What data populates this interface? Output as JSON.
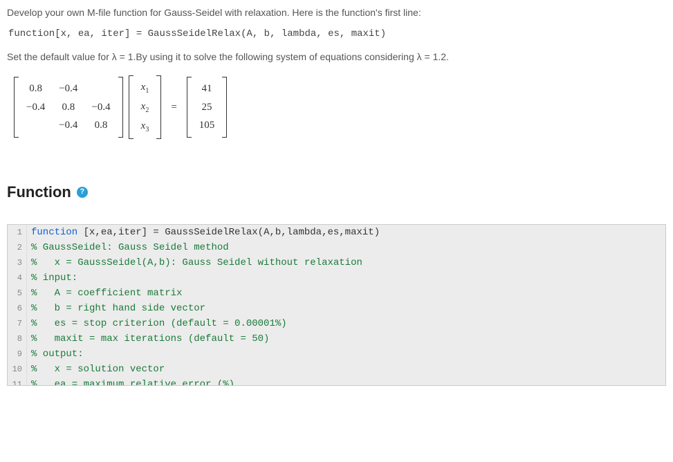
{
  "problem": {
    "intro": "Develop your own M-file function for Gauss-Seidel with relaxation. Here is the function's first line:",
    "code_signature_pre": "function",
    "code_signature_mid": "[x, ea, iter] = GaussSeidelRelax(A, b, lambda, es, maxit)",
    "text2_a": "Set the default value for λ = 1.By using it to solve the following system of equations considering λ = 1.2."
  },
  "matrixA": {
    "r1c1": "0.8",
    "r1c2": "−0.4",
    "r1c3": "",
    "r2c1": "−0.4",
    "r2c2": "0.8",
    "r2c3": "−0.4",
    "r3c1": "",
    "r3c2": "−0.4",
    "r3c3": "0.8"
  },
  "xvec": {
    "x1": "x",
    "x1s": "1",
    "x2": "x",
    "x2s": "2",
    "x3": "x",
    "x3s": "3"
  },
  "eq": "=",
  "bvec": {
    "b1": "41",
    "b2": "25",
    "b3": "105"
  },
  "section": {
    "title": "Function",
    "help": "?"
  },
  "code": {
    "lines": [
      {
        "n": "1",
        "kw": "function",
        "rest": " [x,ea,iter] = GaussSeidelRelax(A,b,lambda,es,maxit)"
      },
      {
        "n": "2",
        "rest": "% GaussSeidel: Gauss Seidel method"
      },
      {
        "n": "3",
        "rest": "%   x = GaussSeidel(A,b): Gauss Seidel without relaxation"
      },
      {
        "n": "4",
        "rest": "% input:"
      },
      {
        "n": "5",
        "rest": "%   A = coefficient matrix"
      },
      {
        "n": "6",
        "rest": "%   b = right hand side vector"
      },
      {
        "n": "7",
        "rest": "%   es = stop criterion (default = 0.00001%)"
      },
      {
        "n": "8",
        "rest": "%   maxit = max iterations (default = 50)"
      },
      {
        "n": "9",
        "rest": "% output:"
      },
      {
        "n": "10",
        "rest": "%   x = solution vector"
      },
      {
        "n": "11",
        "rest": "%   ea = maximum relative error (%)"
      }
    ]
  }
}
